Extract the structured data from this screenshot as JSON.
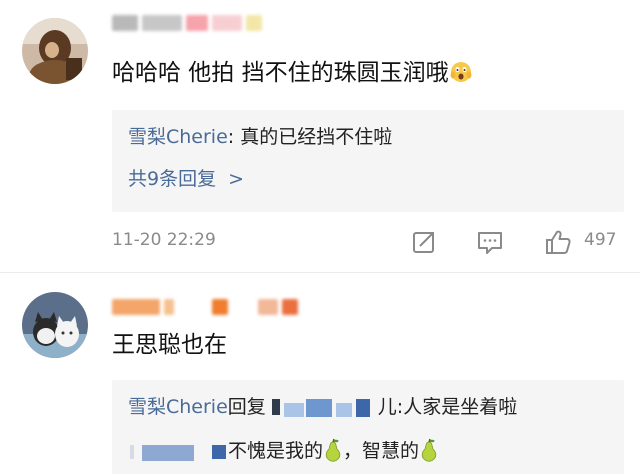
{
  "comments": [
    {
      "text": "哈哈哈 他拍 挡不住的珠圆玉润哦",
      "emoji": "scream-emoji",
      "reply_preview": {
        "user": "雪梨Cherie",
        "separator": ": ",
        "text": "真的已经挡不住啦"
      },
      "more_replies_label": "共9条回复",
      "more_replies_chevron": ">",
      "timestamp": "11-20 22:29",
      "like_count": "497"
    },
    {
      "text": "王思聪也在",
      "reply_preview": {
        "user": "雪梨Cherie",
        "reply_word": "回复",
        "tail": "儿:人家是坐着啦"
      },
      "second_line": {
        "text": "不愧是我的",
        "middle": "，智慧的"
      }
    }
  ],
  "colors": {
    "link_blue": "#4a6b97",
    "meta_gray": "#8a8a8a",
    "reply_bg": "#f5f5f5"
  },
  "icons": {
    "share": "share-icon",
    "comment": "comment-icon",
    "like": "thumbs-up-icon",
    "pear": "pear-emoji"
  }
}
